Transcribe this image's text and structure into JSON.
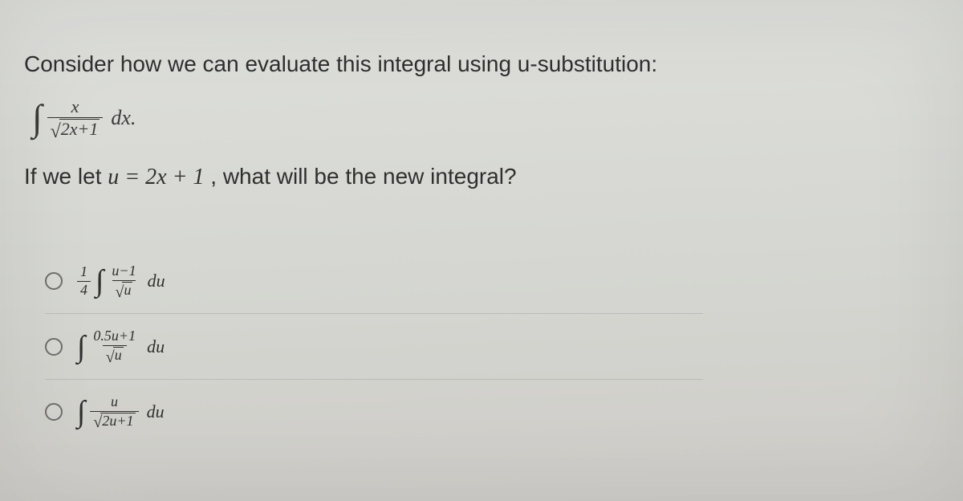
{
  "prompt": "Consider how we can evaluate this integral using u-substitution:",
  "integral": {
    "sign": "∫",
    "numerator": "x",
    "sqrt_sym": "√",
    "denominator_inside_sqrt": "2x+1",
    "differential": "dx."
  },
  "sub_line": {
    "prefix": "If we let ",
    "math": "u = 2x + 1",
    "suffix": ", what will be the new integral?"
  },
  "options": [
    {
      "id": "opt-a",
      "leading_frac": {
        "num": "1",
        "den": "4"
      },
      "int_sign": "∫",
      "frac": {
        "num": "u−1",
        "den_sqrt": "u"
      },
      "sqrt_sym": "√",
      "du": "du"
    },
    {
      "id": "opt-b",
      "leading_frac": null,
      "int_sign": "∫",
      "frac": {
        "num": "0.5u+1",
        "den_sqrt": "u"
      },
      "sqrt_sym": "√",
      "du": "du"
    },
    {
      "id": "opt-c",
      "leading_frac": null,
      "int_sign": "∫",
      "frac": {
        "num": "u",
        "den_sqrt": "2u+1"
      },
      "sqrt_sym": "√",
      "du": "du"
    }
  ]
}
